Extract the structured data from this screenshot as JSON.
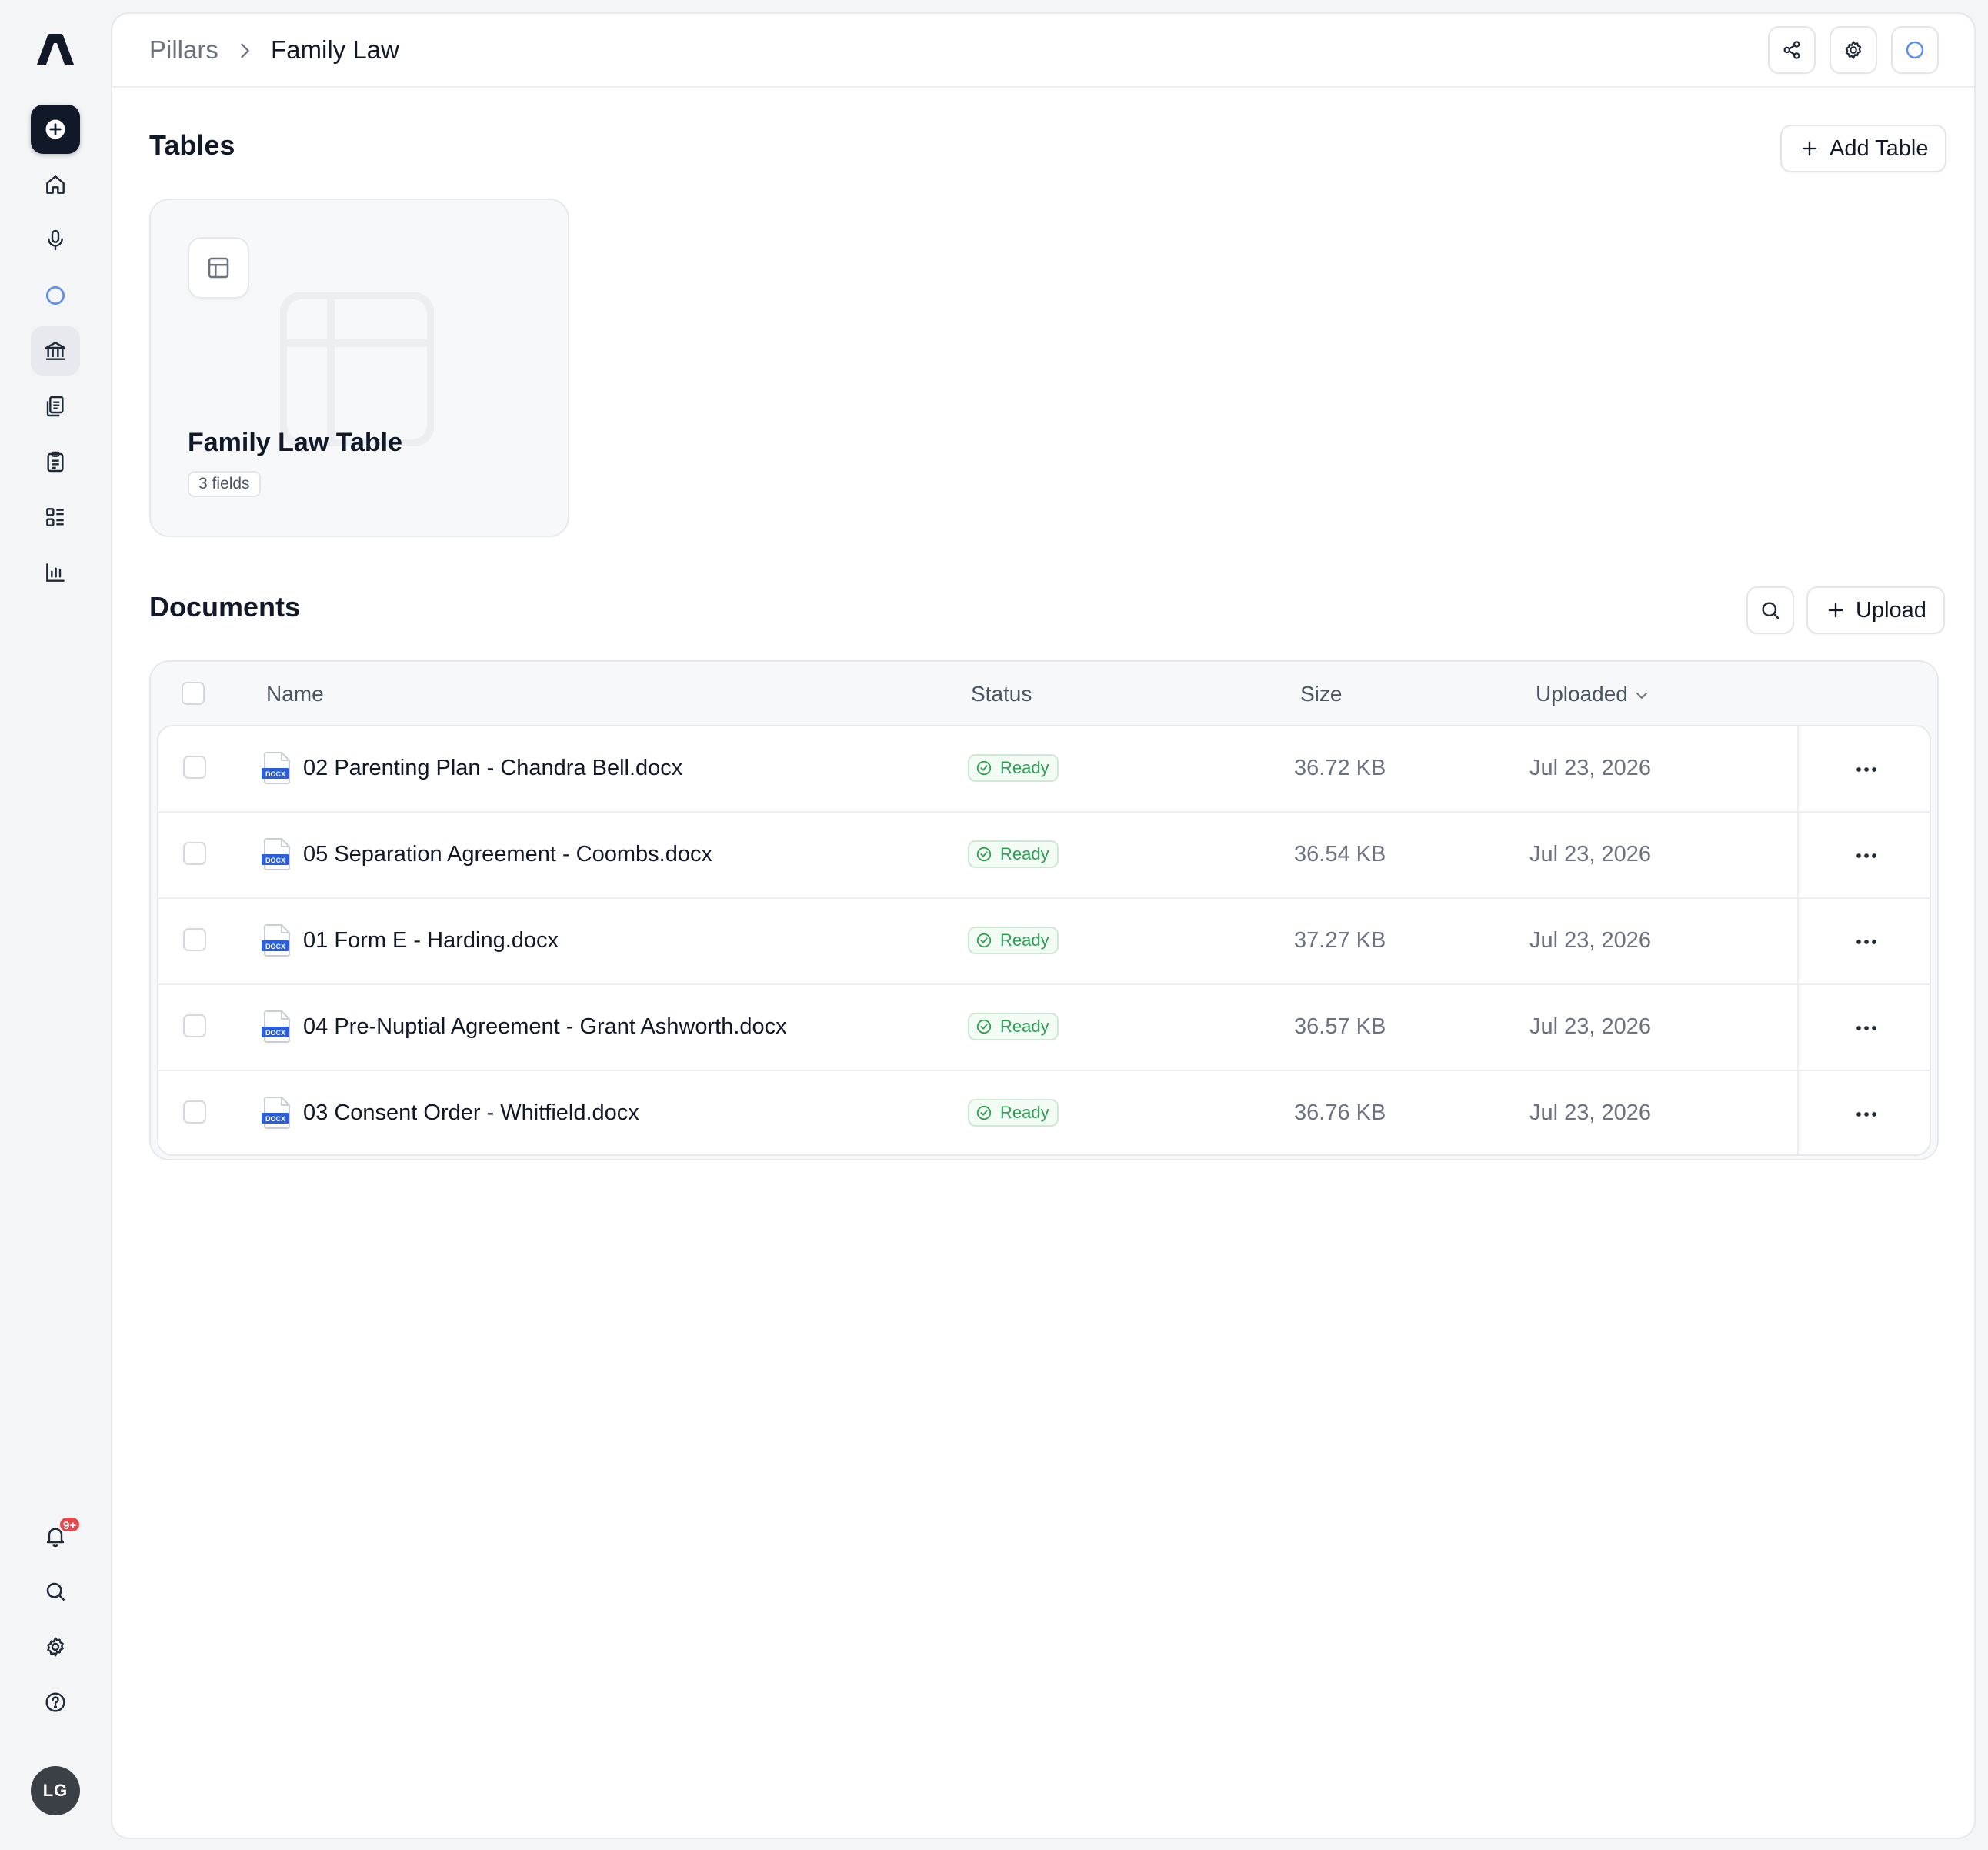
{
  "breadcrumb": {
    "parent": "Pillars",
    "current": "Family Law"
  },
  "tables_section": {
    "title": "Tables",
    "add_button_label": "Add Table"
  },
  "table_card": {
    "title": "Family Law Table",
    "fields_tag": "3 fields"
  },
  "documents_section": {
    "title": "Documents",
    "upload_button_label": "Upload"
  },
  "documents_table": {
    "columns": {
      "name": "Name",
      "status": "Status",
      "size": "Size",
      "uploaded": "Uploaded"
    },
    "rows": [
      {
        "name": "02 Parenting Plan - Chandra Bell.docx",
        "status": "Ready",
        "size": "36.72 KB",
        "uploaded": "Jul 23, 2026"
      },
      {
        "name": "05 Separation Agreement - Coombs.docx",
        "status": "Ready",
        "size": "36.54 KB",
        "uploaded": "Jul 23, 2026"
      },
      {
        "name": "01 Form E - Harding.docx",
        "status": "Ready",
        "size": "37.27 KB",
        "uploaded": "Jul 23, 2026"
      },
      {
        "name": "04 Pre-Nuptial Agreement - Grant Ashworth.docx",
        "status": "Ready",
        "size": "36.57 KB",
        "uploaded": "Jul 23, 2026"
      },
      {
        "name": "03 Consent Order - Whitfield.docx",
        "status": "Ready",
        "size": "36.76 KB",
        "uploaded": "Jul 23, 2026"
      }
    ]
  },
  "file_type_label": "DOCX",
  "notifications": {
    "badge": "9+"
  },
  "user": {
    "initials": "LG"
  },
  "sidebar_icons": [
    "new-item-icon",
    "home-icon",
    "microphone-icon",
    "circle-status-icon",
    "bank-icon",
    "documents-icon",
    "clipboard-icon",
    "list-icon",
    "bar-chart-icon",
    "bell-icon",
    "search-icon",
    "gear-icon",
    "help-icon"
  ],
  "colors": {
    "accent_dark": "#111827",
    "status_ready": "#2f9e55",
    "file_blue": "#2b5fd9",
    "badge_red": "#e5484d"
  }
}
